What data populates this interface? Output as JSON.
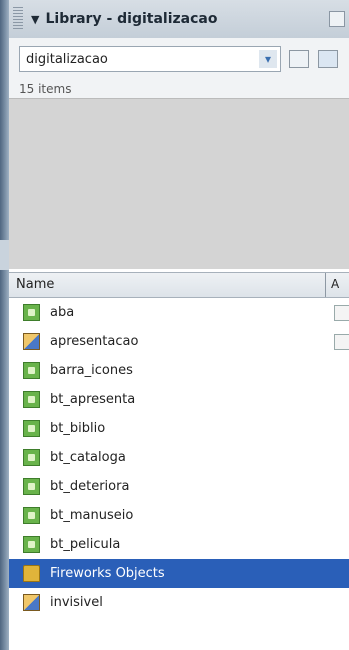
{
  "panel": {
    "title": "Library - digitalizacao",
    "document_selector": "digitalizacao",
    "item_count": "15 items"
  },
  "columns": {
    "name": "Name",
    "next": "A"
  },
  "items": [
    {
      "label": "aba",
      "icon": "button-symbol-icon"
    },
    {
      "label": "apresentacao",
      "icon": "movieclip-symbol-icon"
    },
    {
      "label": "barra_icones",
      "icon": "button-symbol-icon"
    },
    {
      "label": "bt_apresenta",
      "icon": "button-symbol-icon"
    },
    {
      "label": "bt_biblio",
      "icon": "button-symbol-icon"
    },
    {
      "label": "bt_cataloga",
      "icon": "button-symbol-icon"
    },
    {
      "label": "bt_deteriora",
      "icon": "button-symbol-icon"
    },
    {
      "label": "bt_manuseio",
      "icon": "button-symbol-icon"
    },
    {
      "label": "bt_pelicula",
      "icon": "button-symbol-icon"
    },
    {
      "label": "Fireworks Objects",
      "icon": "folder-icon",
      "selected": true
    },
    {
      "label": "invisivel",
      "icon": "movieclip-symbol-icon"
    }
  ],
  "colors": {
    "selection": "#2a5fb8",
    "header": "#c4ced8",
    "preview_bg": "#d4d4d4"
  }
}
